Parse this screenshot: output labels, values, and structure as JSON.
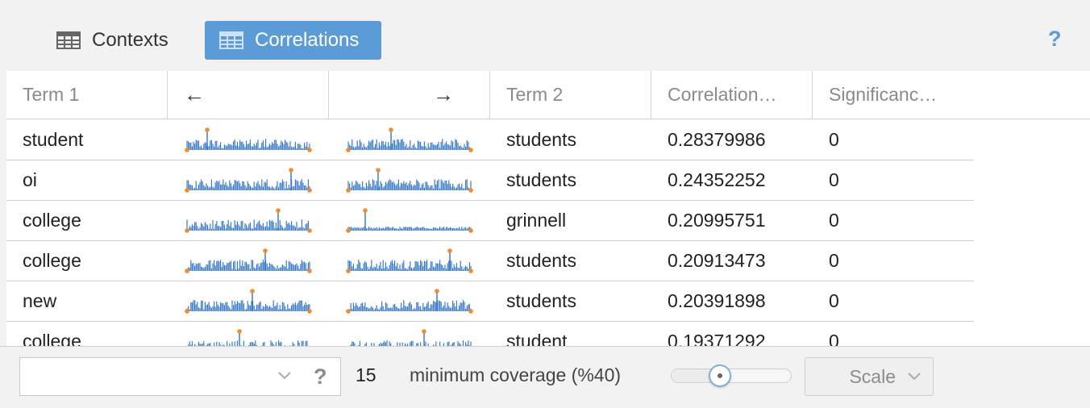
{
  "tabs": {
    "contexts": {
      "label": "Contexts",
      "icon": "table-icon"
    },
    "correlations": {
      "label": "Correlations",
      "icon": "table-icon",
      "active": true
    },
    "help": "?"
  },
  "colors": {
    "accent": "#5b9bd8",
    "spark_bar": "#3a7cc7",
    "spark_dot": "#f08c2a"
  },
  "table": {
    "columns": [
      "Term 1",
      "←",
      "→",
      "Term 2",
      "Correlation…",
      "Significanc…"
    ],
    "rows": [
      {
        "term1": "student",
        "term2": "students",
        "correlation": "0.28379986",
        "significance": "0"
      },
      {
        "term1": "oi",
        "term2": "students",
        "correlation": "0.24352252",
        "significance": "0"
      },
      {
        "term1": "college",
        "term2": "grinnell",
        "correlation": "0.20995751",
        "significance": "0"
      },
      {
        "term1": "college",
        "term2": "students",
        "correlation": "0.20913473",
        "significance": "0"
      },
      {
        "term1": "new",
        "term2": "students",
        "correlation": "0.20391898",
        "significance": "0"
      },
      {
        "term1": "college",
        "term2": "student",
        "correlation": "0.19371292",
        "significance": "0"
      }
    ]
  },
  "toolbar": {
    "combo_value": "",
    "combo_help": "?",
    "count": "15",
    "min_coverage_label": "minimum coverage (%40)",
    "slider_value": 0.4,
    "scale_label": "Scale"
  }
}
